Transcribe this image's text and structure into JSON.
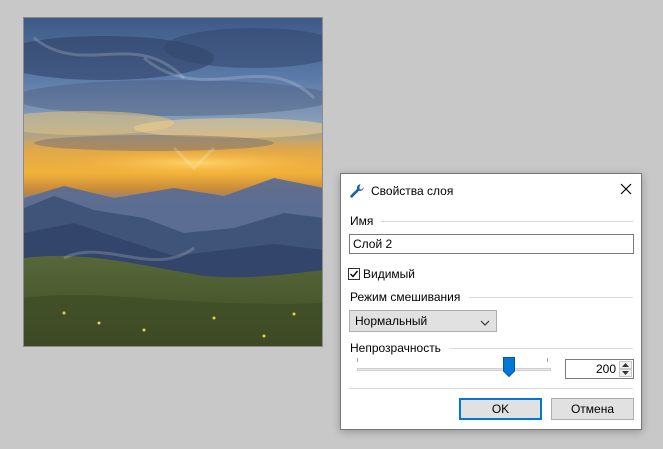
{
  "dialog": {
    "title": "Свойства слоя",
    "name_section": "Имя",
    "name_value": "Слой 2",
    "visible_label": "Видимый",
    "visible_checked": true,
    "blend_section": "Режим смешивания",
    "blend_value": "Нормальный",
    "opacity_section": "Непрозрачность",
    "opacity_value": "200",
    "opacity_max": 255,
    "ok_label": "OK",
    "cancel_label": "Отмена"
  },
  "icons": {
    "title": "wrench-icon",
    "close": "close-icon",
    "dropdown": "chevron-down-icon",
    "spin_up": "arrow-up-icon",
    "spin_down": "arrow-down-icon"
  },
  "colors": {
    "accent": "#0078d7",
    "button_bg": "#e1e1e1",
    "workspace_bg": "#c8c8c8"
  }
}
